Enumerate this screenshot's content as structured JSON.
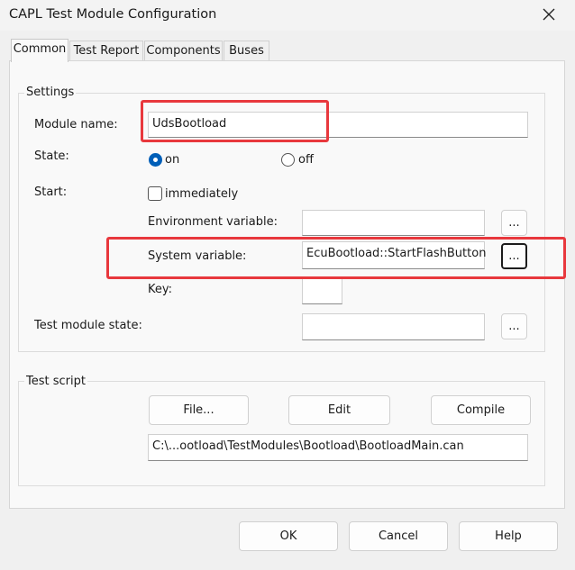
{
  "window": {
    "title": "CAPL Test Module Configuration"
  },
  "tabs": [
    {
      "label": "Common",
      "active": true
    },
    {
      "label": "Test Report",
      "active": false
    },
    {
      "label": "Components",
      "active": false
    },
    {
      "label": "Buses",
      "active": false
    }
  ],
  "settings": {
    "group_label": "Settings",
    "module_name_label": "Module name:",
    "module_name_value": "UdsBootload",
    "state_label": "State:",
    "state_options": [
      {
        "label": "on",
        "selected": true
      },
      {
        "label": "off",
        "selected": false
      }
    ],
    "start_label": "Start:",
    "immediately_label": "immediately",
    "immediately_checked": false,
    "env_var_label": "Environment variable:",
    "env_var_value": "",
    "sys_var_label": "System variable:",
    "sys_var_value": "EcuBootload::StartFlashButton",
    "key_label": "Key:",
    "key_value": "",
    "test_module_state_label": "Test module state:",
    "test_module_state_value": "",
    "browse_label": "..."
  },
  "test_script": {
    "group_label": "Test script",
    "file_button": "File...",
    "edit_button": "Edit",
    "compile_button": "Compile",
    "path_value": "C:\\...ootload\\TestModules\\Bootload\\BootloadMain.can"
  },
  "footer": {
    "ok": "OK",
    "cancel": "Cancel",
    "help": "Help"
  },
  "colors": {
    "highlight": "#e8383d",
    "accent": "#005fb8"
  }
}
